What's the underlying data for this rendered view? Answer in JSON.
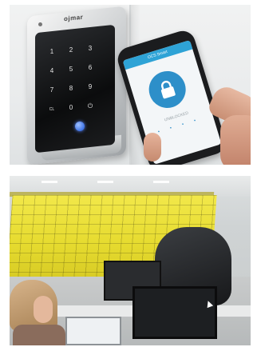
{
  "top_image": {
    "brand_label": "ojmar",
    "keypad": {
      "keys": [
        "1",
        "2",
        "3",
        "4",
        "5",
        "6",
        "7",
        "8",
        "9",
        "CL",
        "0",
        "⏻"
      ],
      "fingerprint_color": "#3f74e6"
    },
    "phone_app": {
      "title": "OCS Smart",
      "status_text": "UNBLOCKED",
      "accent_color": "#2d8fc9"
    }
  },
  "bottom_image": {
    "locker_color": "#e6db2f",
    "scene": "office-locker-wall"
  }
}
